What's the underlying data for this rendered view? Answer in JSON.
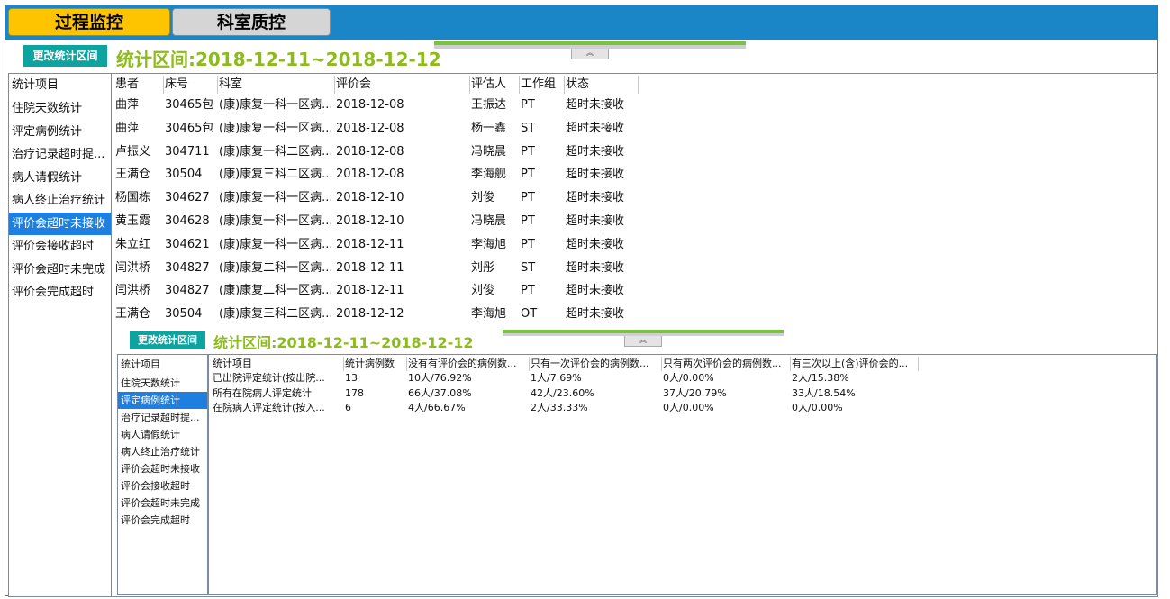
{
  "tabs": {
    "active": "过程监控",
    "inactive": "科室质控"
  },
  "top_section": {
    "change_range_label": "更改统计区间",
    "range_text": "统计区间:2018-12-11~2018-12-12",
    "collapse_glyph": "︽",
    "stat_list": {
      "header": "统计项目",
      "items": [
        "住院天数统计",
        "评定病例统计",
        "治疗记录超时提...",
        "病人请假统计",
        "病人终止治疗统计",
        "评价会超时未接收",
        "评价会接收超时",
        "评价会超时未完成",
        "评价会完成超时"
      ],
      "selected_index": 5
    },
    "table": {
      "columns": [
        "患者",
        "床号",
        "科室",
        "评价会",
        "评估人",
        "工作组",
        "状态"
      ],
      "rows": [
        [
          "曲萍",
          "30465包",
          "(康)康复一科一区病...",
          "2018-12-08",
          "王振达",
          "PT",
          "超时未接收"
        ],
        [
          "曲萍",
          "30465包",
          "(康)康复一科一区病...",
          "2018-12-08",
          "杨一鑫",
          "ST",
          "超时未接收"
        ],
        [
          "卢振义",
          "304711",
          "(康)康复一科二区病...",
          "2018-12-08",
          "冯晓晨",
          "PT",
          "超时未接收"
        ],
        [
          "王满仓",
          "30504",
          "(康)康复三科二区病...",
          "2018-12-08",
          "李海舰",
          "PT",
          "超时未接收"
        ],
        [
          "杨国栋",
          "304627",
          "(康)康复一科一区病...",
          "2018-12-10",
          "刘俊",
          "PT",
          "超时未接收"
        ],
        [
          "黄玉霞",
          "304628",
          "(康)康复一科一区病...",
          "2018-12-10",
          "冯晓晨",
          "PT",
          "超时未接收"
        ],
        [
          "朱立红",
          "304621",
          "(康)康复一科一区病...",
          "2018-12-11",
          "李海旭",
          "PT",
          "超时未接收"
        ],
        [
          "闫洪桥",
          "304827",
          "(康)康复二科一区病...",
          "2018-12-11",
          "刘彤",
          "ST",
          "超时未接收"
        ],
        [
          "闫洪桥",
          "304827",
          "(康)康复二科一区病...",
          "2018-12-11",
          "刘俊",
          "PT",
          "超时未接收"
        ],
        [
          "王满仓",
          "30504",
          "(康)康复三科二区病...",
          "2018-12-12",
          "李海旭",
          "OT",
          "超时未接收"
        ]
      ]
    }
  },
  "bottom_section": {
    "change_range_label": "更改统计区间",
    "range_text": "统计区间:2018-12-11~2018-12-12",
    "collapse_glyph": "︽",
    "stat_list": {
      "header": "统计项目",
      "items": [
        "住院天数统计",
        "评定病例统计",
        "治疗记录超时提...",
        "病人请假统计",
        "病人终止治疗统计",
        "评价会超时未接收",
        "评价会接收超时",
        "评价会超时未完成",
        "评价会完成超时"
      ],
      "selected_index": 1
    },
    "table": {
      "columns": [
        "统计项目",
        "统计病例数",
        "没有有评价会的病例数...",
        "只有一次评价会的病例数...",
        "只有两次评价会的病例数...",
        "有三次以上(含)评价会的..."
      ],
      "rows": [
        [
          "已出院评定统计(按出院...",
          "13",
          "10人/76.92%",
          "1人/7.69%",
          "0人/0.00%",
          "2人/15.38%"
        ],
        [
          "所有在院病人评定统计",
          "178",
          "66人/37.08%",
          "42人/23.60%",
          "37人/20.79%",
          "33人/18.54%"
        ],
        [
          "在院病人评定统计(按入...",
          "6",
          "4人/66.67%",
          "2人/33.33%",
          "0人/0.00%",
          "0人/0.00%"
        ]
      ]
    }
  }
}
